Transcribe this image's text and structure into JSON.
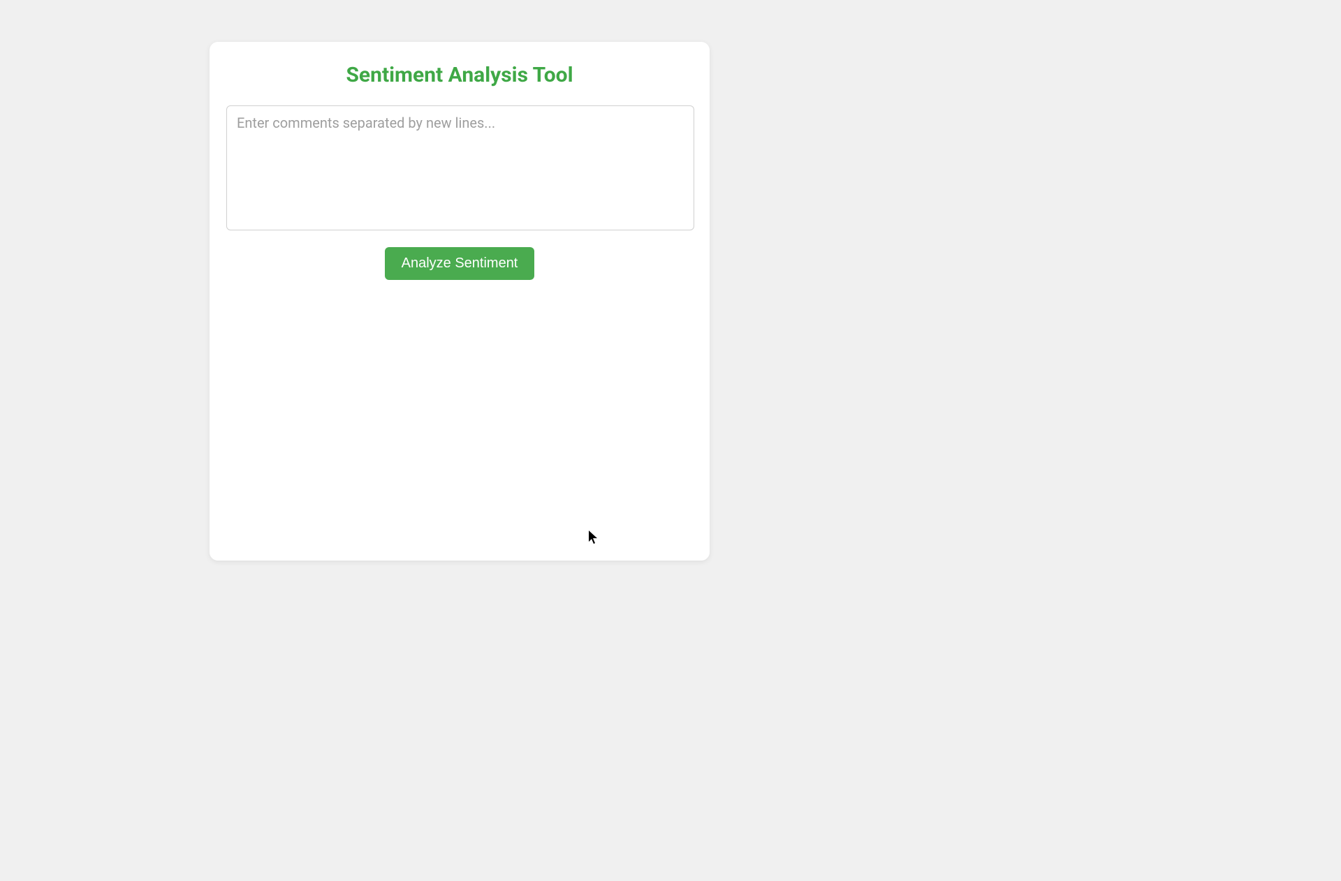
{
  "app": {
    "title": "Sentiment Analysis Tool"
  },
  "input": {
    "placeholder": "Enter comments separated by new lines...",
    "value": ""
  },
  "button": {
    "analyze_label": "Analyze Sentiment"
  },
  "colors": {
    "accent": "#3fa846",
    "button_bg": "#4aab4f",
    "page_bg": "#f0f0f0",
    "card_bg": "#ffffff"
  }
}
